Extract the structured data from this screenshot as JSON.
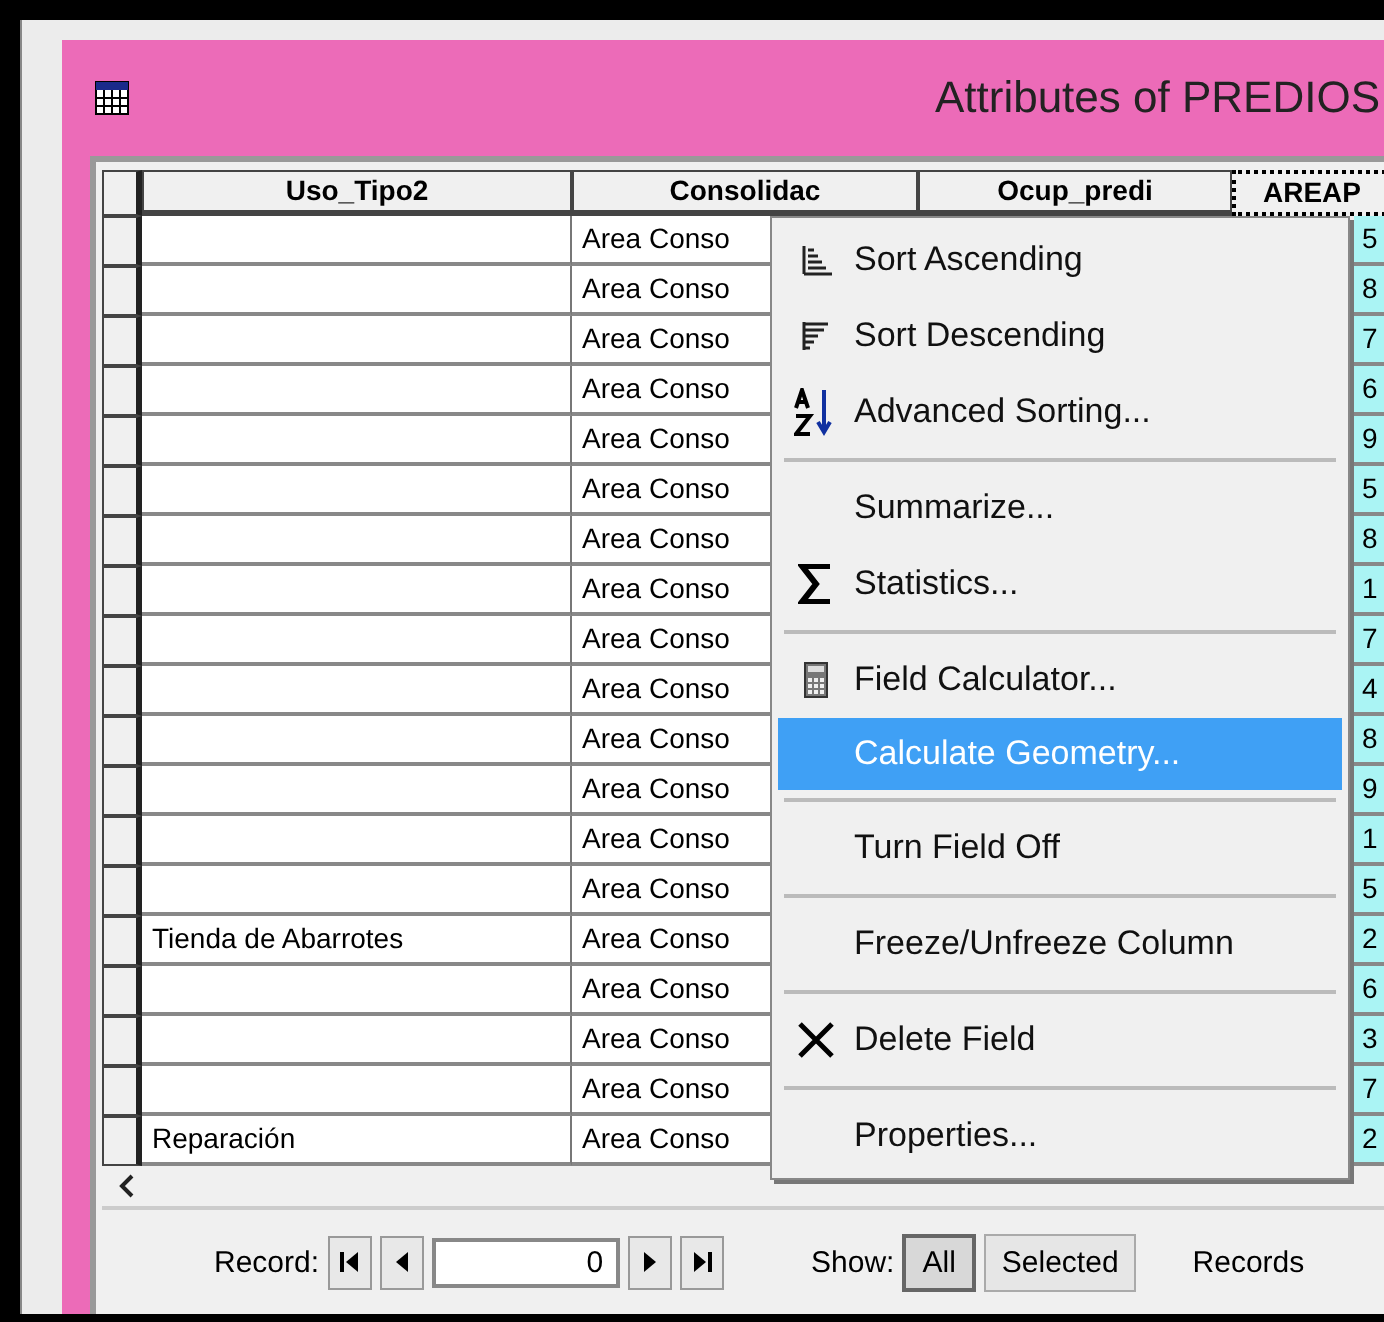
{
  "window": {
    "title": "Attributes of PREDIOS"
  },
  "table": {
    "columns": [
      "Uso_Tipo2",
      "Consolidac",
      "Ocup_predi",
      "AREAP"
    ],
    "rows": [
      {
        "uso": "",
        "conso": "Area Conso",
        "areap": "5"
      },
      {
        "uso": "",
        "conso": "Area Conso",
        "areap": "8"
      },
      {
        "uso": "",
        "conso": "Area Conso",
        "areap": "7"
      },
      {
        "uso": "",
        "conso": "Area Conso",
        "areap": "6"
      },
      {
        "uso": "",
        "conso": "Area Conso",
        "areap": "9"
      },
      {
        "uso": "",
        "conso": "Area Conso",
        "areap": "5"
      },
      {
        "uso": "",
        "conso": "Area Conso",
        "areap": "8"
      },
      {
        "uso": "",
        "conso": "Area Conso",
        "areap": "1"
      },
      {
        "uso": "",
        "conso": "Area Conso",
        "areap": "7"
      },
      {
        "uso": "",
        "conso": "Area Conso",
        "areap": "4"
      },
      {
        "uso": "",
        "conso": "Area Conso",
        "areap": "8"
      },
      {
        "uso": "",
        "conso": "Area Conso",
        "areap": "9"
      },
      {
        "uso": "",
        "conso": "Area Conso",
        "areap": "1"
      },
      {
        "uso": "",
        "conso": "Area Conso",
        "areap": "5"
      },
      {
        "uso": "Tienda de Abarrotes",
        "conso": "Area Conso",
        "areap": "2"
      },
      {
        "uso": "",
        "conso": "Area Conso",
        "areap": "6"
      },
      {
        "uso": "",
        "conso": "Area Conso",
        "areap": "3"
      },
      {
        "uso": "",
        "conso": "Area Conso",
        "areap": "7"
      },
      {
        "uso": "Reparación",
        "conso": "Area Conso",
        "areap": "2"
      }
    ]
  },
  "context_menu": [
    {
      "kind": "item",
      "label": "Sort Ascending",
      "selected": false
    },
    {
      "kind": "item",
      "label": "Sort Descending",
      "selected": false
    },
    {
      "kind": "item",
      "label": "Advanced Sorting...",
      "selected": false
    },
    {
      "kind": "separator"
    },
    {
      "kind": "item",
      "label": "Summarize...",
      "selected": false
    },
    {
      "kind": "item",
      "label": "Statistics...",
      "selected": false
    },
    {
      "kind": "separator"
    },
    {
      "kind": "item",
      "label": "Field Calculator...",
      "selected": false
    },
    {
      "kind": "item",
      "label": "Calculate Geometry...",
      "selected": true
    },
    {
      "kind": "separator"
    },
    {
      "kind": "item",
      "label": "Turn Field Off",
      "selected": false
    },
    {
      "kind": "separator"
    },
    {
      "kind": "item",
      "label": "Freeze/Unfreeze Column",
      "selected": false
    },
    {
      "kind": "separator"
    },
    {
      "kind": "item",
      "label": "Delete Field",
      "selected": false
    },
    {
      "kind": "separator"
    },
    {
      "kind": "item",
      "label": "Properties...",
      "selected": false
    }
  ],
  "navigator": {
    "record_label": "Record:",
    "record_value": "0",
    "show_label": "Show:",
    "show_options": [
      {
        "label": "All",
        "selected": true
      },
      {
        "label": "Selected",
        "selected": false
      }
    ],
    "records_label": "Records"
  }
}
